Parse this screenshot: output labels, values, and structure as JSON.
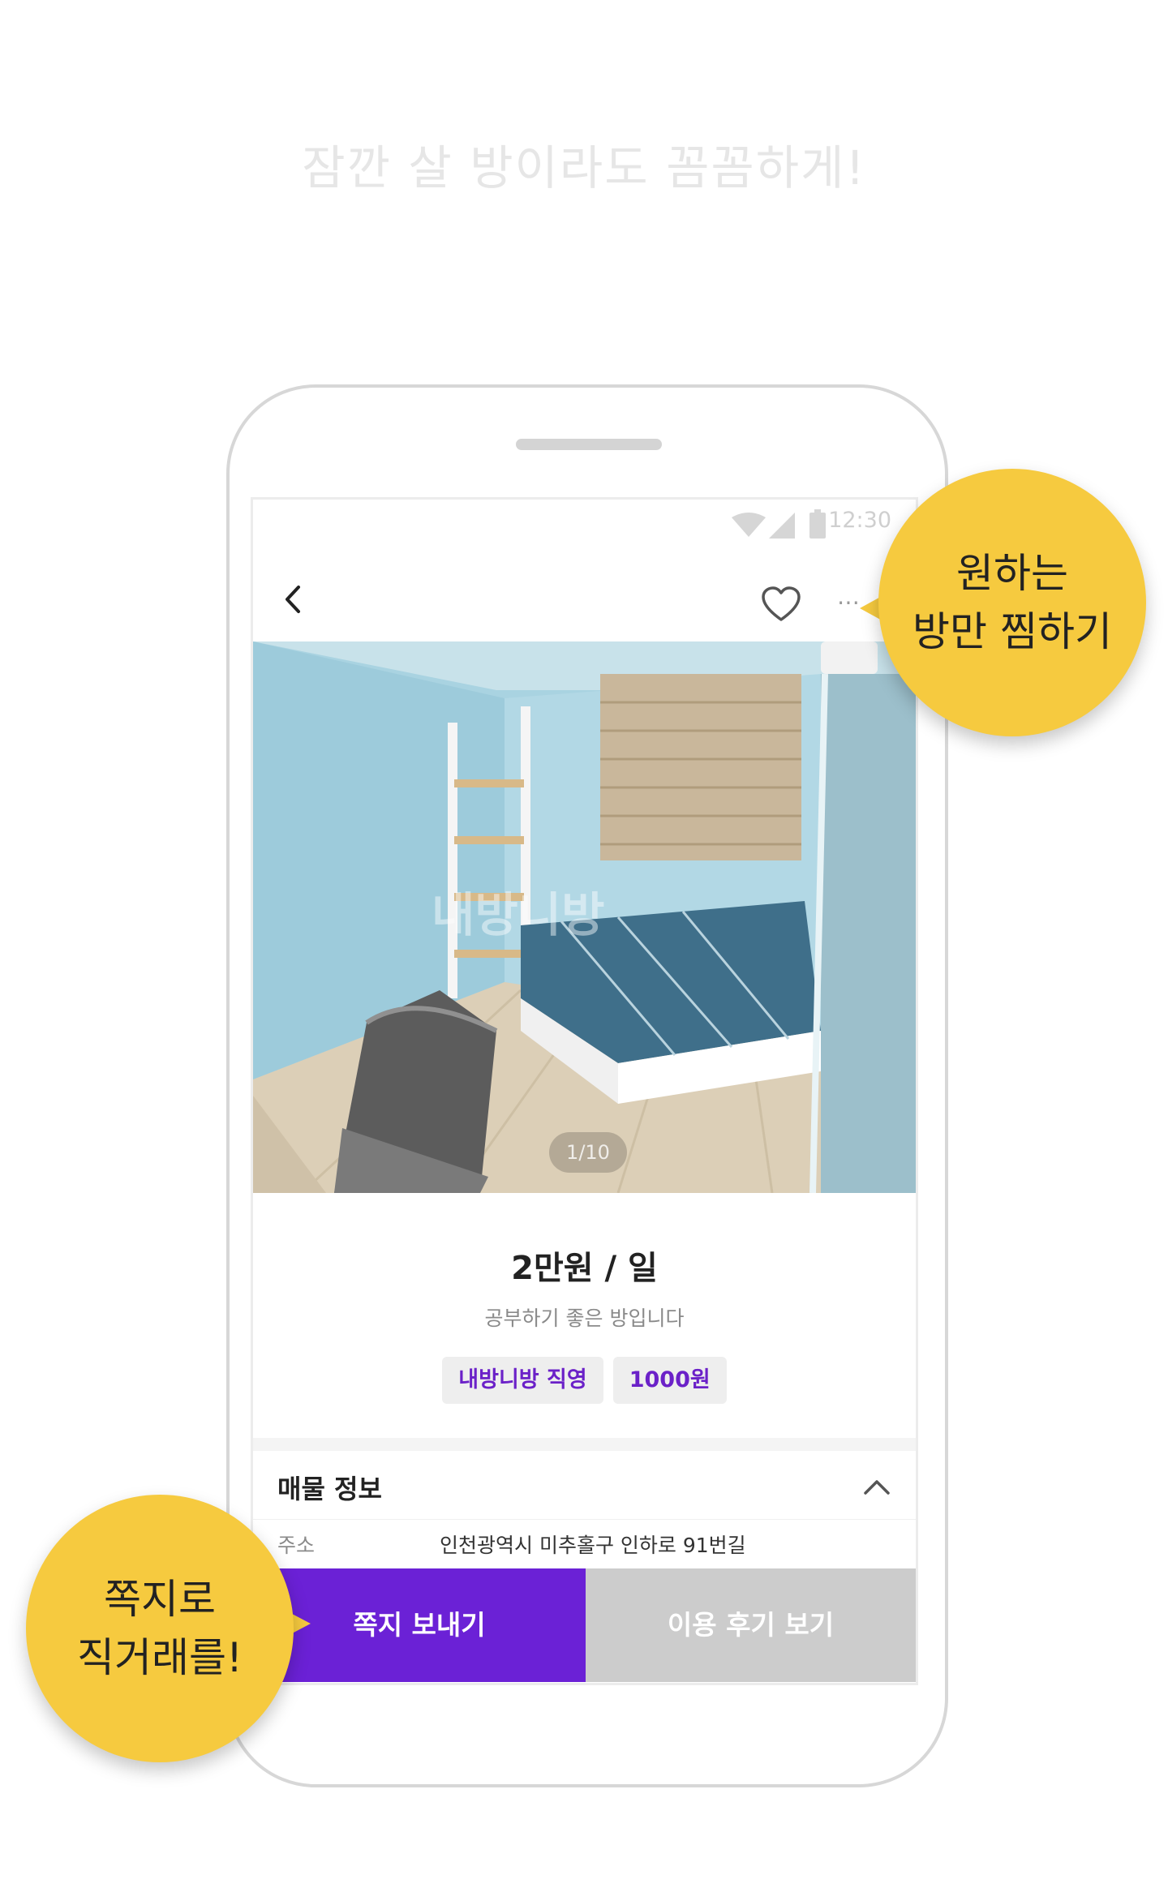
{
  "promo": {
    "headline": "잠깐 살 방이라도 꼼꼼하게!"
  },
  "status_bar": {
    "time": "12:30",
    "icons": [
      "wifi-icon",
      "signal-icon",
      "battery-icon"
    ]
  },
  "app_bar": {
    "icons": [
      "back-icon",
      "heart-icon",
      "more-icon"
    ]
  },
  "listing": {
    "photo_counter": "1/10",
    "watermark": "내방니방",
    "price": "2만원 / 일",
    "subtitle": "공부하기 좋은 방입니다",
    "tags": [
      "내방니방 직영",
      "1000원"
    ]
  },
  "property_info": {
    "title": "매물 정보",
    "address_label": "주소",
    "address_value": "인천광역시 미추홀구 인하로 91번길"
  },
  "actions": {
    "message_label": "쪽지 보내기",
    "review_label": "이용 후기 보기"
  },
  "bubbles": {
    "top_text": "원하는\n방만 찜하기",
    "bottom_text": "쪽지로\n직거래를!"
  },
  "colors": {
    "accent": "#6b21d6",
    "tag_text": "#6b21c8",
    "bubble": "#f6ca3f",
    "secondary_button": "#cccccc"
  }
}
